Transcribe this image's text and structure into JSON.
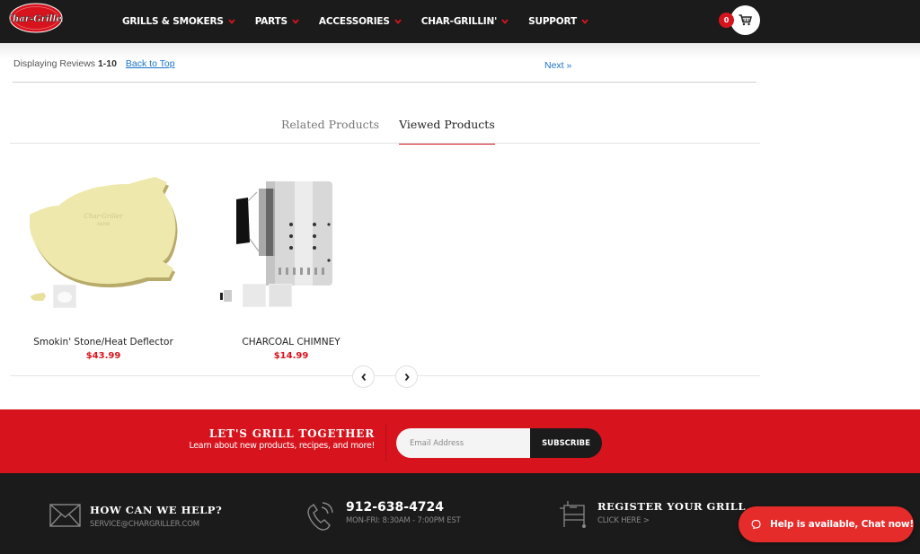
{
  "header": {
    "logo_alt": "Char-Griller",
    "nav": [
      {
        "label": "GRILLS & SMOKERS"
      },
      {
        "label": "PARTS"
      },
      {
        "label": "ACCESSORIES"
      },
      {
        "label": "CHAR-GRILLIN'"
      },
      {
        "label": "SUPPORT"
      }
    ],
    "cart_count": "0"
  },
  "reviews": {
    "displaying_prefix": "Displaying Reviews ",
    "range": "1-10",
    "back_to_top": "Back to Top",
    "next": "Next »"
  },
  "tabs": [
    {
      "label": "Related Products",
      "active": false
    },
    {
      "label": "Viewed Products",
      "active": true
    }
  ],
  "products": [
    {
      "name": "Smokin' Stone/Heat Deflector",
      "price": "$43.99",
      "image": "heat-deflector-stone"
    },
    {
      "name": "CHARCOAL CHIMNEY",
      "price": "$14.99",
      "image": "charcoal-chimney"
    }
  ],
  "newsletter": {
    "title": "LET'S GRILL TOGETHER",
    "subtitle": "Learn about new products, recipes, and more!",
    "email_placeholder": "Email Address",
    "subscribe_label": "SUBSCRIBE"
  },
  "footer": {
    "help_title": "HOW CAN WE HELP?",
    "help_email": "SERVICE@CHARGRILLER.COM",
    "phone": "912-638-4724",
    "hours": "MON-FRI: 8:30AM - 7:00PM EST",
    "register_title": "REGISTER YOUR GRILL",
    "register_link": "CLICK HERE >"
  },
  "chat": {
    "label": "Help is available, Chat now!"
  },
  "colors": {
    "brand_red": "#d7141e",
    "header_dark": "#1b1b1b",
    "link_blue": "#1a73c8",
    "chat_red": "#e62b2b"
  }
}
